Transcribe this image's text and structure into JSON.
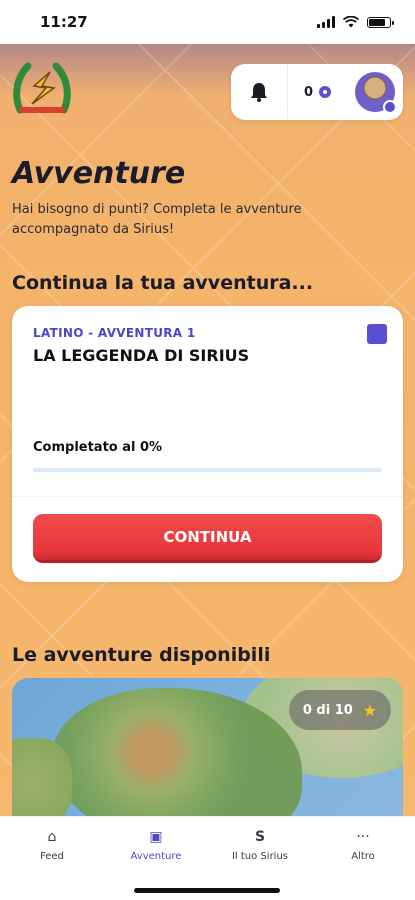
{
  "status_bar": {
    "time": "11:27"
  },
  "header": {
    "notifications_count": "",
    "points": "0"
  },
  "page": {
    "title": "Avventure",
    "subtitle": "Hai bisogno di punti? Completa le avventure accompagnato da Sirius!"
  },
  "continue_section": {
    "heading": "Continua la tua avventura...",
    "card": {
      "category": "LATINO - AVVENTURA 1",
      "title": "LA LEGGENDA DI SIRIUS",
      "progress_label": "Completato al 0%",
      "progress_percent": 0,
      "button_label": "CONTINUA"
    }
  },
  "available_section": {
    "heading": "Le avventure disponibili",
    "first_card": {
      "stars_label": "0 di 10"
    }
  },
  "tabbar": {
    "items": [
      {
        "label": "Feed",
        "icon": "home-icon"
      },
      {
        "label": "Avventure",
        "icon": "adventure-icon",
        "active": true
      },
      {
        "label": "Il tuo Sirius",
        "icon": "sirius-logo-icon"
      },
      {
        "label": "Altro",
        "icon": "more-icon"
      }
    ]
  },
  "colors": {
    "accent": "#4e46c9",
    "cta": "#e8373c",
    "background": "#f4b36a"
  }
}
